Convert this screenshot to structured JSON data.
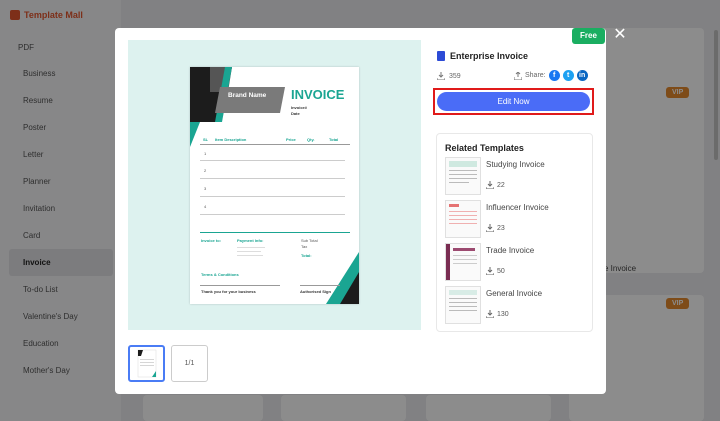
{
  "app": {
    "brand": "Template Mall",
    "sidebar_header": "PDF",
    "sidebar_items": [
      "Business",
      "Resume",
      "Poster",
      "Letter",
      "Planner",
      "Invitation",
      "Card",
      "Invoice",
      "To-do List",
      "Valentine's Day",
      "Education",
      "Mother's Day"
    ],
    "active_item": "Invoice",
    "bg_vip_label": "VIP",
    "bg_invoice_caption": "e Invoice"
  },
  "modal": {
    "free_badge": "Free",
    "close_symbol": "✕",
    "template_title": "Enterprise Invoice",
    "download_count": "359",
    "share_label": "Share:",
    "edit_button": "Edit Now",
    "page_indicator": "1/1",
    "related_title": "Related Templates",
    "related": [
      {
        "name": "Studying Invoice",
        "count": "22"
      },
      {
        "name": "Influencer Invoice",
        "count": "23"
      },
      {
        "name": "Trade Invoice",
        "count": "50"
      },
      {
        "name": "General Invoice",
        "count": "130"
      }
    ]
  },
  "invoice_doc": {
    "title": "INVOICE",
    "brand": "Brand Name",
    "invoice_no": "Invoice#",
    "date": "Date",
    "col_no": "SL",
    "col_desc": "Item Description",
    "col_price": "Price",
    "col_qty": "Qty.",
    "col_total": "Total",
    "rows": [
      "1",
      "2",
      "3",
      "4"
    ],
    "invoice_to": "Invoice to:",
    "payment_info": "Payment Info:",
    "sub_total": "Sub Total",
    "tax": "Tax",
    "total": "Total:",
    "terms": "Terms & Conditions",
    "thanks": "Thank you for your business",
    "sign": "Authorised Sign"
  },
  "colors": {
    "accent_blue": "#4a6cf7",
    "free_green": "#1aae61",
    "highlight_red": "#e01a1a",
    "invoice_teal": "#1aa592",
    "brand_orange": "#e4572e"
  }
}
